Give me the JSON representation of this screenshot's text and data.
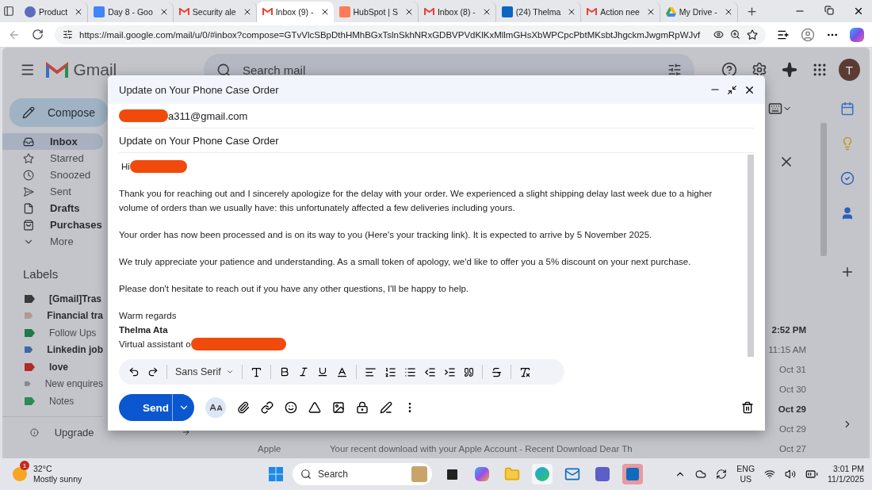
{
  "browser": {
    "tabs": [
      {
        "title": "Product",
        "kind": "round",
        "selected": false
      },
      {
        "title": "Day 8 - Goo",
        "kind": "doc",
        "selected": false
      },
      {
        "title": "Security ale",
        "kind": "gmail",
        "selected": false
      },
      {
        "title": "Inbox (9) - ",
        "kind": "gmail",
        "selected": true
      },
      {
        "title": "HubSpot | S",
        "kind": "hubspot",
        "selected": false
      },
      {
        "title": "Inbox (8) -",
        "kind": "gmail",
        "selected": false
      },
      {
        "title": "(24) Thelma",
        "kind": "linkedin",
        "selected": false
      },
      {
        "title": "Action nee",
        "kind": "gmail",
        "selected": false
      },
      {
        "title": "My Drive -",
        "kind": "drive",
        "selected": false
      }
    ],
    "url": "https://mail.google.com/mail/u/0/#inbox?compose=GTvVlcSBpDthHMhBGxTslnSkhNRxGDBVPVdKlKxMllmGHsXbWPCpcPbtMKsbtJhgckmJwgmRpWJvf"
  },
  "gmail": {
    "logo": "Gmail",
    "search_placeholder": "Search mail",
    "avatar": "T",
    "compose": "Compose",
    "nav": [
      {
        "label": "Inbox",
        "selected": true,
        "unread": true
      },
      {
        "label": "Starred",
        "selected": false,
        "unread": false
      },
      {
        "label": "Snoozed",
        "selected": false,
        "unread": false
      },
      {
        "label": "Sent",
        "selected": false,
        "unread": false
      },
      {
        "label": "Drafts",
        "selected": false,
        "unread": true
      },
      {
        "label": "Purchases",
        "selected": false,
        "unread": true
      },
      {
        "label": "More",
        "selected": false,
        "unread": false
      }
    ],
    "labels_title": "Labels",
    "labels": [
      {
        "label": "[Gmail]Tras",
        "color": "#3a3a3c",
        "unread": true
      },
      {
        "label": "Financial tra",
        "color": "#b39a90",
        "unread": true
      },
      {
        "label": "Follow Ups",
        "color": "#1e7a48",
        "unread": false
      },
      {
        "label": "Linkedin job",
        "color": "#3f67a8",
        "unread": true
      },
      {
        "label": "love",
        "color": "#b32b25",
        "unread": true
      },
      {
        "label": "New enquires",
        "color": "#8a8a8e",
        "unread": false
      },
      {
        "label": "Notes",
        "color": "#2e8a55",
        "unread": false
      }
    ],
    "upgrade": "Upgrade",
    "list": [
      {
        "date": "2:52 PM",
        "unread": true
      },
      {
        "date": "11:15 AM",
        "unread": false
      },
      {
        "date": "Oct 31",
        "unread": false
      },
      {
        "date": "Oct 30",
        "unread": false
      },
      {
        "date": "Oct 29",
        "unread": true
      },
      {
        "date": "Oct 29",
        "unread": false
      },
      {
        "date": "Oct 27",
        "unread": false,
        "sender": "Apple",
        "subject": "Your recent download with your Apple Account - Recent Download Dear Th"
      }
    ]
  },
  "compose": {
    "title": "Update on Your Phone Case Order",
    "to": "a311@gmail.com",
    "subject": "Update on Your Phone Case Order",
    "greeting": "Hi",
    "paragraphs": [
      "Thank you for reaching out and I sincerely apologize for the delay with your order. We experienced a slight shipping delay last week due to a higher volume of orders than we usually have: this unfortunately affected a few deliveries including yours.",
      "Your order has now been processed and is on its way to you (Here's your tracking link). It is expected to arrive by 5 November 2025.",
      "We truly appreciate your patience and understanding. As a small token of apology, we'd like to offer you a 5% discount on your next purchase.",
      "Please don't hesitate to reach out if you have any other questions, I'll be happy to help."
    ],
    "signoff": "Warm regards",
    "name": "Thelma Ata",
    "role": "Virtual assistant o",
    "font": "Sans Serif",
    "send": "Send"
  },
  "taskbar": {
    "temperature": "32°C",
    "weather": "Mostly sunny",
    "badge": "1",
    "search_placeholder": "Search",
    "lang": "ENG",
    "region": "US",
    "time": "3:01 PM",
    "date": "11/1/2025"
  }
}
